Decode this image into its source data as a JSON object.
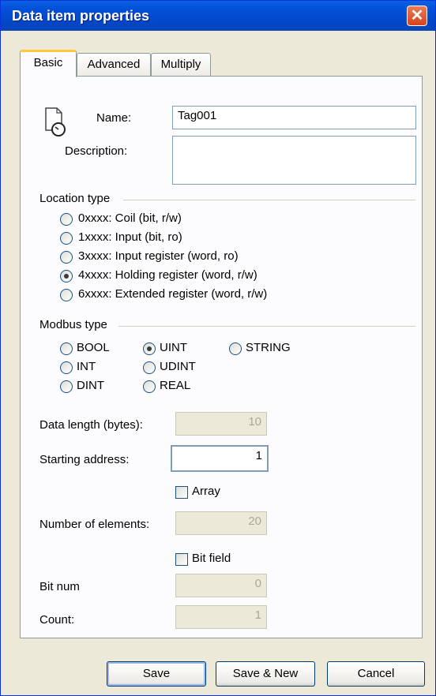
{
  "window": {
    "title": "Data item properties",
    "close_glyph": "✕"
  },
  "tabs": [
    {
      "label": "Basic"
    },
    {
      "label": "Advanced"
    },
    {
      "label": "Multiply"
    }
  ],
  "basic": {
    "name_label": "Name:",
    "name_value": "Tag001",
    "description_label": "Description:",
    "description_value": "",
    "location_type": {
      "label": "Location type",
      "options": [
        {
          "label": "0xxxx: Coil (bit, r/w)",
          "selected": false
        },
        {
          "label": "1xxxx: Input (bit, ro)",
          "selected": false
        },
        {
          "label": "3xxxx: Input register (word, ro)",
          "selected": false
        },
        {
          "label": "4xxxx: Holding register (word, r/w)",
          "selected": true
        },
        {
          "label": "6xxxx: Extended register (word, r/w)",
          "selected": false
        }
      ]
    },
    "modbus_type": {
      "label": "Modbus type",
      "options": [
        {
          "label": "BOOL",
          "selected": false
        },
        {
          "label": "UINT",
          "selected": true
        },
        {
          "label": "STRING",
          "selected": false
        },
        {
          "label": "INT",
          "selected": false
        },
        {
          "label": "UDINT",
          "selected": false
        },
        {
          "label": "DINT",
          "selected": false
        },
        {
          "label": "REAL",
          "selected": false
        }
      ]
    },
    "data_length_label": "Data length (bytes):",
    "data_length_value": "10",
    "starting_address_label": "Starting address:",
    "starting_address_value": "1",
    "array_label": "Array",
    "array_checked": false,
    "num_elements_label": "Number of elements:",
    "num_elements_value": "20",
    "bitfield_label": "Bit field",
    "bitfield_checked": false,
    "bit_num_label": "Bit num",
    "bit_num_value": "0",
    "count_label": "Count:",
    "count_value": "1"
  },
  "buttons": {
    "save": "Save",
    "save_new": "Save & New",
    "cancel": "Cancel"
  },
  "icons": {
    "tag": "tag-gauge-icon"
  },
  "colors": {
    "title_bar": "#0350d8",
    "close": "#d8431c",
    "tab_highlight": "#ffc73c"
  }
}
